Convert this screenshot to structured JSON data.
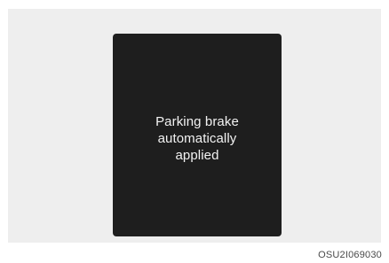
{
  "display": {
    "message": "Parking brake\nautomatically\napplied"
  },
  "figure": {
    "code": "OSU2I069030"
  }
}
